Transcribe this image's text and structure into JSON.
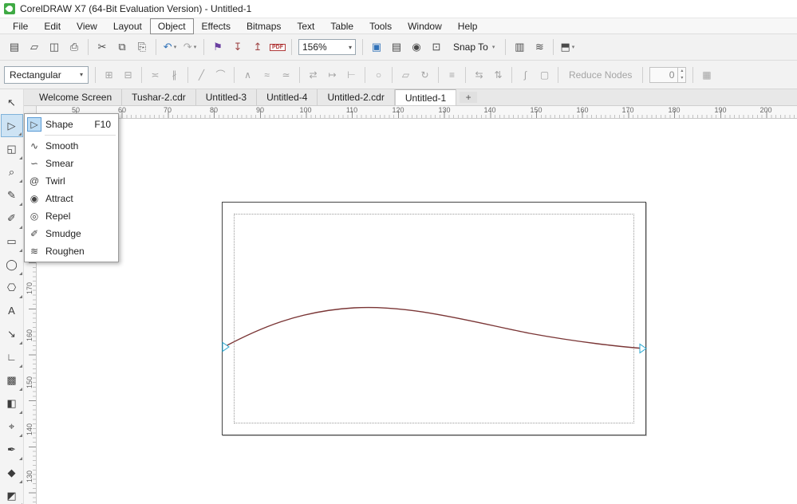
{
  "window": {
    "title": "CorelDRAW X7 (64-Bit Evaluation Version) - Untitled-1"
  },
  "menubar": {
    "items": [
      {
        "label": "File"
      },
      {
        "label": "Edit"
      },
      {
        "label": "View"
      },
      {
        "label": "Layout"
      },
      {
        "label": "Object"
      },
      {
        "label": "Effects"
      },
      {
        "label": "Bitmaps"
      },
      {
        "label": "Text"
      },
      {
        "label": "Table"
      },
      {
        "label": "Tools"
      },
      {
        "label": "Window"
      },
      {
        "label": "Help"
      }
    ]
  },
  "toolbar": {
    "zoom_value": "156%",
    "snap_label": "Snap To",
    "icons": {
      "new": "▤",
      "open": "▱",
      "save": "◫",
      "print": "⎙",
      "cut": "✂",
      "copy": "⧉",
      "paste": "⎘",
      "undo": "↶",
      "redo": "↷",
      "dropdown": "▾",
      "search_content": "⚑",
      "import": "↧",
      "export": "↥",
      "pdf": "PDF",
      "fullscreen": "▣",
      "rulers": "▤",
      "guidelines": "◉",
      "snap_frame": "⊡",
      "welcome": "▥",
      "options": "≋",
      "launcher": "⬒"
    }
  },
  "property_bar": {
    "mode_value": "Rectangular",
    "reduce_nodes_label": "Reduce Nodes",
    "smoothness_value": "0",
    "icons": {
      "add_node": "⊞",
      "delete_node": "⊟",
      "join_nodes": "≍",
      "break_curve": "∦",
      "to_line": "╱",
      "to_curve": "⌒",
      "cusp": "∧",
      "smooth": "≈",
      "symmetrical": "≃",
      "reverse": "⇄",
      "extend": "↦",
      "extract": "⊢",
      "close_curve": "○",
      "stretch": "▱",
      "rotate": "↻",
      "align": "≡",
      "reflect_h": "⇆",
      "reflect_v": "⇅",
      "elastic": "∫",
      "select_all": "▢",
      "box_select": "▦",
      "spin_up": "▴",
      "spin_down": "▾"
    }
  },
  "tabs": {
    "items": [
      {
        "label": "Welcome Screen"
      },
      {
        "label": "Tushar-2.cdr"
      },
      {
        "label": "Untitled-3"
      },
      {
        "label": "Untitled-4"
      },
      {
        "label": "Untitled-2.cdr"
      },
      {
        "label": "Untitled-1"
      }
    ],
    "new_tab_label": "+"
  },
  "rulers": {
    "horizontal": [
      "50",
      "60",
      "70",
      "80",
      "90",
      "100",
      "110",
      "120",
      "130",
      "140",
      "150",
      "160",
      "170",
      "180",
      "190",
      "200"
    ],
    "vertical": [
      "170",
      "160",
      "150",
      "140",
      "130"
    ]
  },
  "toolbox": {
    "tools": [
      {
        "name": "pick",
        "glyph": "↖"
      },
      {
        "name": "shape",
        "glyph": "▷"
      },
      {
        "name": "crop",
        "glyph": "◱"
      },
      {
        "name": "zoom",
        "glyph": "⌕"
      },
      {
        "name": "freehand",
        "glyph": "✎"
      },
      {
        "name": "artistic-media",
        "glyph": "✐"
      },
      {
        "name": "rectangle",
        "glyph": "▭"
      },
      {
        "name": "ellipse",
        "glyph": "◯"
      },
      {
        "name": "polygon",
        "glyph": "⎔"
      },
      {
        "name": "text",
        "glyph": "A"
      },
      {
        "name": "parallel-dimension",
        "glyph": "↘"
      },
      {
        "name": "connector",
        "glyph": "∟"
      },
      {
        "name": "drop-shadow",
        "glyph": "▩"
      },
      {
        "name": "transparency",
        "glyph": "◧"
      },
      {
        "name": "color-eyedropper",
        "glyph": "⌖"
      },
      {
        "name": "outline-pen",
        "glyph": "✒"
      },
      {
        "name": "edit-fill",
        "glyph": "◆"
      },
      {
        "name": "interactive-fill",
        "glyph": "◩"
      }
    ]
  },
  "flyout": {
    "items": [
      {
        "label": "Shape",
        "shortcut": "F10",
        "glyph": "▷"
      },
      {
        "label": "Smooth",
        "shortcut": "",
        "glyph": "∿"
      },
      {
        "label": "Smear",
        "shortcut": "",
        "glyph": "∽"
      },
      {
        "label": "Twirl",
        "shortcut": "",
        "glyph": "@"
      },
      {
        "label": "Attract",
        "shortcut": "",
        "glyph": "◉"
      },
      {
        "label": "Repel",
        "shortcut": "",
        "glyph": "◎"
      },
      {
        "label": "Smudge",
        "shortcut": "",
        "glyph": "✐"
      },
      {
        "label": "Roughen",
        "shortcut": "",
        "glyph": "≋"
      }
    ]
  },
  "canvas": {
    "curve_color": "#7a3535",
    "node_color": "#2aa9d2"
  }
}
